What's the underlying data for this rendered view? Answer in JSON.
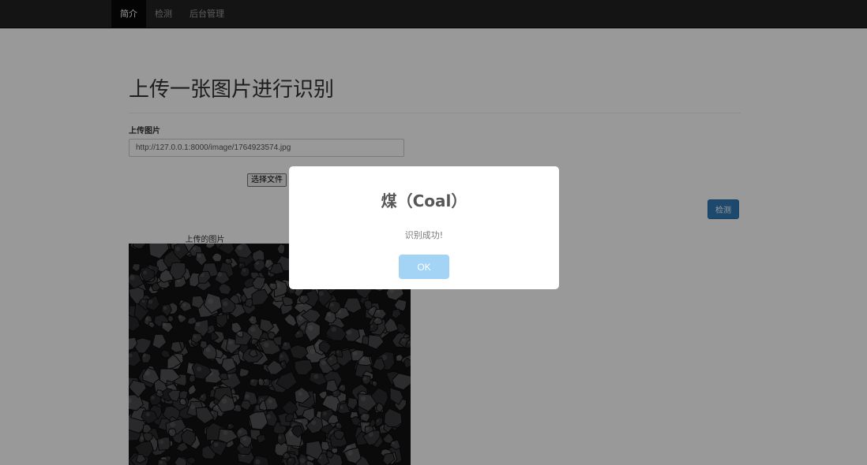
{
  "nav": {
    "items": [
      {
        "label": "简介",
        "active": true
      },
      {
        "label": "检测",
        "active": false
      },
      {
        "label": "后台管理",
        "active": false
      }
    ]
  },
  "page": {
    "title": "上传一张图片进行识别",
    "upload_label": "上传图片",
    "image_url": "http://127.0.0.1:8000/image/1764923574.jpg",
    "file_button_label": "选择文件",
    "detect_button_label": "检测",
    "image_caption": "上传的图片"
  },
  "modal": {
    "title": "煤（Coal）",
    "message": "识别成功!",
    "ok_label": "OK"
  },
  "colors": {
    "navbar": "#222222",
    "primary_button": "#337ab7",
    "ok_button": "#a3d3f5",
    "overlay": "rgba(0,0,0,0.4)"
  }
}
